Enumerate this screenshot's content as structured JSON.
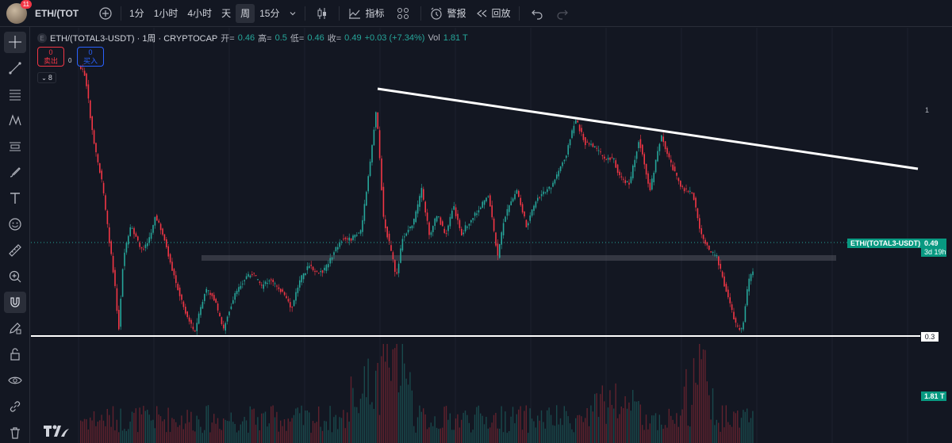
{
  "topbar": {
    "notification_count": "11",
    "symbol": "ETH/(TOT",
    "intervals": [
      "1分",
      "1小时",
      "4小时",
      "天",
      "周",
      "15分"
    ],
    "active_interval": "周",
    "indicators_label": "指标",
    "alert_label": "警报",
    "replay_label": "回放"
  },
  "legend": {
    "dot_label": "E",
    "title": "ETH/(TOTAL3-USDT) · 1周 · CRYPTOCAP",
    "open_label": "开=",
    "open": "0.46",
    "high_label": "高=",
    "high": "0.5",
    "low_label": "低=",
    "low": "0.46",
    "close_label": "收=",
    "close": "0.49",
    "change": "+0.03 (+7.34%)",
    "vol_label": "Vol",
    "vol": "1.81 T"
  },
  "trade": {
    "sell_count": "0",
    "sell_label": "卖出",
    "spread": "0",
    "buy_count": "0",
    "buy_label": "买入"
  },
  "collapse": {
    "count": "8"
  },
  "price_scale": {
    "top_label": "1",
    "symbol_tag": "ETH/(TOTAL3-USDT)",
    "last_price": "0.49",
    "countdown": "3d 19h",
    "level_label": "0.3",
    "volume_tag": "1.81 T"
  },
  "colors": {
    "background": "#131722",
    "up": "#26a69a",
    "down": "#f23645",
    "trendline": "#ffffff"
  },
  "icons": {
    "crosshair": "crosshair-icon",
    "trend_line": "trend-line-icon",
    "text": "text-icon"
  }
}
